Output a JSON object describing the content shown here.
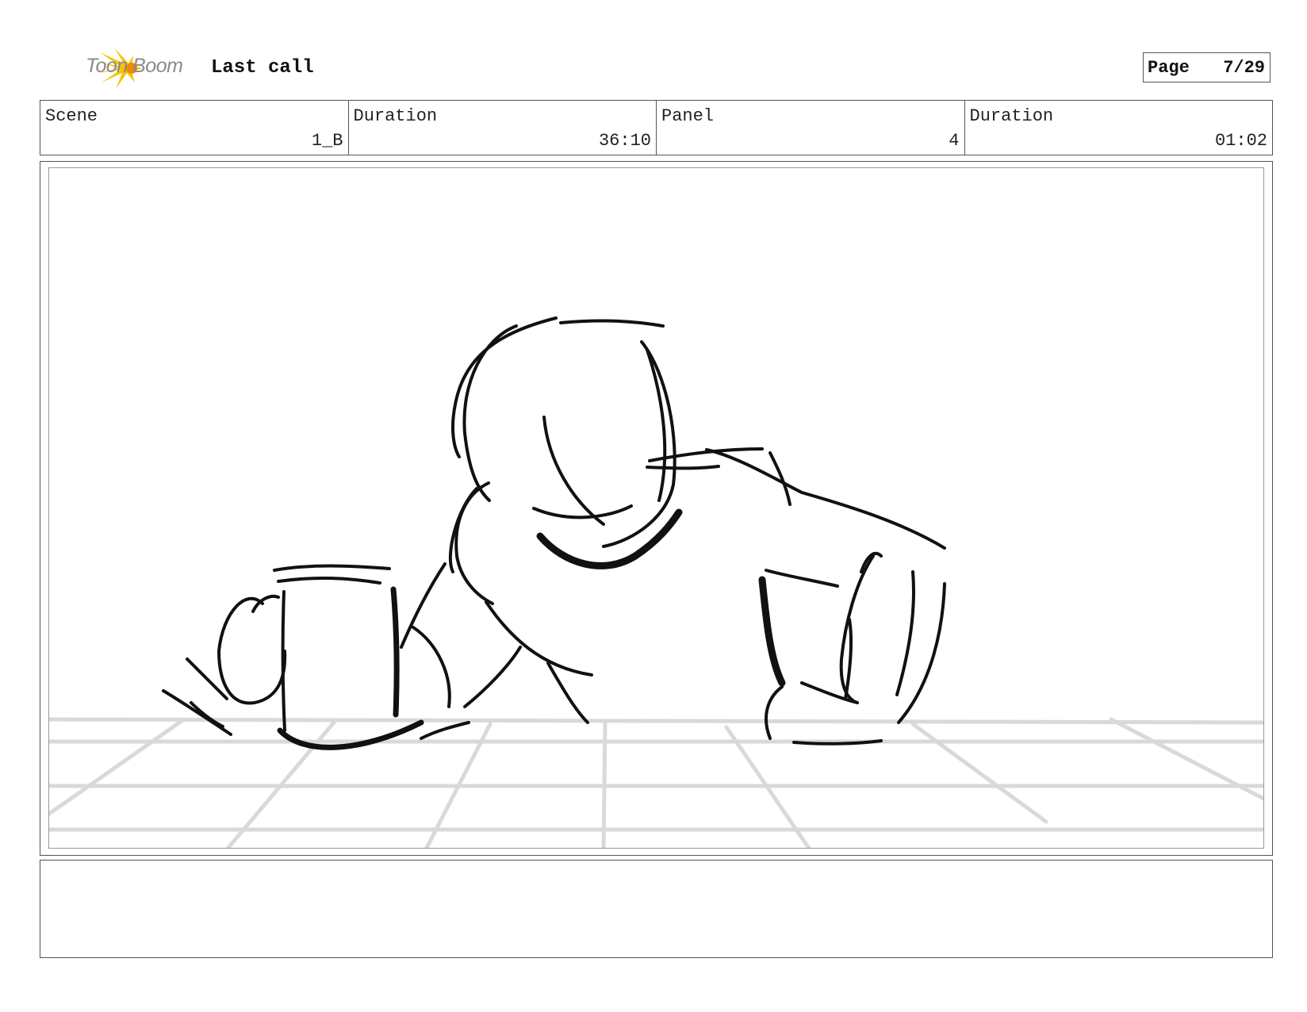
{
  "header": {
    "brand": "Toon Boom",
    "project_title": "Last call",
    "page_label": "Page",
    "page_value": "7/29"
  },
  "info": {
    "scene_label": "Scene",
    "scene_value": "1_B",
    "scene_duration_label": "Duration",
    "scene_duration_value": "36:10",
    "panel_label": "Panel",
    "panel_value": "4",
    "panel_duration_label": "Duration",
    "panel_duration_value": "01:02"
  },
  "colors": {
    "logo_yellow": "#f5c400",
    "logo_orange": "#f08a00",
    "sketch_line": "#111111",
    "floor_grid": "#d9d9d9"
  },
  "notes": {
    "text": ""
  }
}
